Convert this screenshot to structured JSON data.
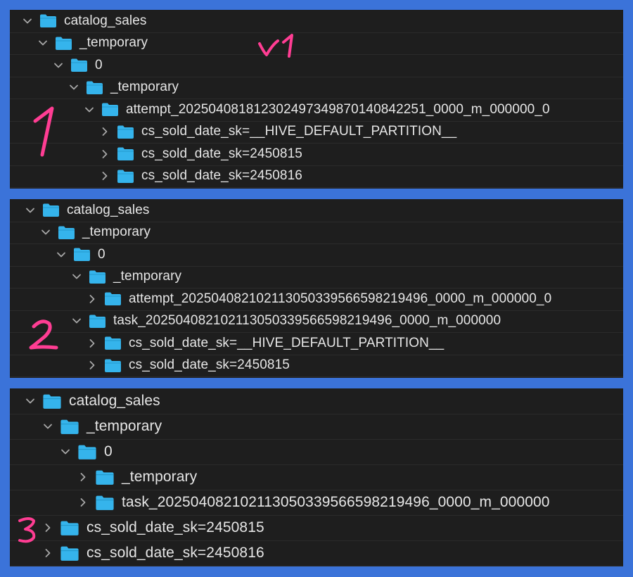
{
  "accent_folder": "#35b4ec",
  "handwritten_color": "#ff3d93",
  "panels": [
    {
      "number_note": "1",
      "version_note": "v1",
      "rows": [
        {
          "label": "catalog_sales",
          "depth": 0,
          "expanded": true
        },
        {
          "label": "_temporary",
          "depth": 1,
          "expanded": true
        },
        {
          "label": "0",
          "depth": 2,
          "expanded": true
        },
        {
          "label": "_temporary",
          "depth": 3,
          "expanded": true
        },
        {
          "label": "attempt_202504081812302497349870140842251_0000_m_000000_0",
          "depth": 4,
          "expanded": true
        },
        {
          "label": "cs_sold_date_sk=__HIVE_DEFAULT_PARTITION__",
          "depth": 5,
          "expanded": false
        },
        {
          "label": "cs_sold_date_sk=2450815",
          "depth": 5,
          "expanded": false
        },
        {
          "label": "cs_sold_date_sk=2450816",
          "depth": 5,
          "expanded": false
        }
      ]
    },
    {
      "number_note": "2",
      "rows": [
        {
          "label": "catalog_sales",
          "depth": 0,
          "expanded": true
        },
        {
          "label": "_temporary",
          "depth": 1,
          "expanded": true
        },
        {
          "label": "0",
          "depth": 2,
          "expanded": true
        },
        {
          "label": "_temporary",
          "depth": 3,
          "expanded": true
        },
        {
          "label": "attempt_202504082102113050339566598219496_0000_m_000000_0",
          "depth": 4,
          "expanded": false
        },
        {
          "label": "task_202504082102113050339566598219496_0000_m_000000",
          "depth": 3,
          "expanded": true
        },
        {
          "label": "cs_sold_date_sk=__HIVE_DEFAULT_PARTITION__",
          "depth": 4,
          "expanded": false
        },
        {
          "label": "cs_sold_date_sk=2450815",
          "depth": 4,
          "expanded": false
        }
      ]
    },
    {
      "number_note": "3",
      "rows": [
        {
          "label": "catalog_sales",
          "depth": 0,
          "expanded": true
        },
        {
          "label": "_temporary",
          "depth": 1,
          "expanded": true
        },
        {
          "label": "0",
          "depth": 2,
          "expanded": true
        },
        {
          "label": "_temporary",
          "depth": 3,
          "expanded": false
        },
        {
          "label": "task_202504082102113050339566598219496_0000_m_000000",
          "depth": 3,
          "expanded": false
        },
        {
          "label": "cs_sold_date_sk=2450815",
          "depth": 1,
          "expanded": false
        },
        {
          "label": "cs_sold_date_sk=2450816",
          "depth": 1,
          "expanded": false
        }
      ]
    }
  ]
}
